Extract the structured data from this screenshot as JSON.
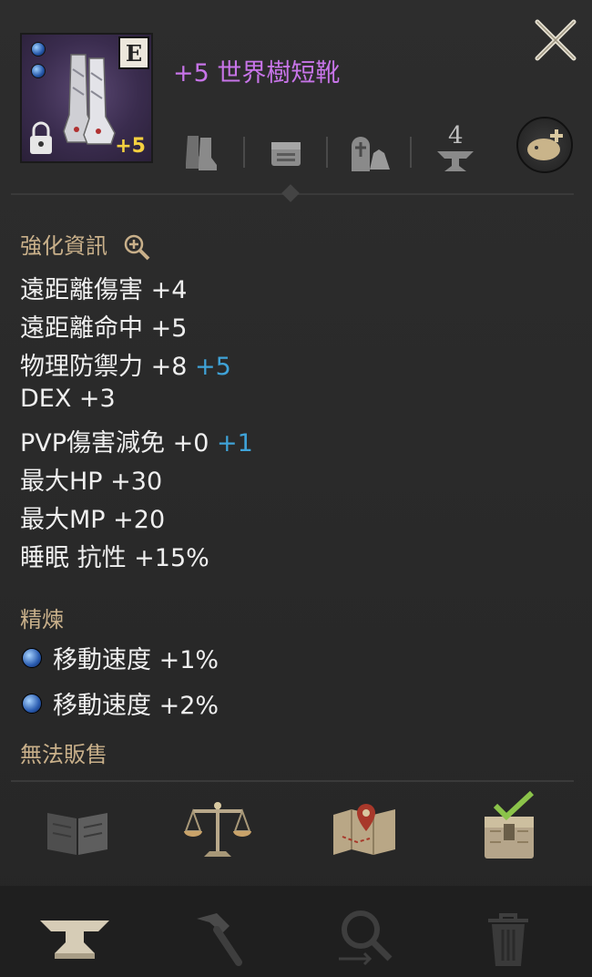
{
  "item": {
    "grade": "E",
    "enchant": "+5",
    "name": "+5 世界樹短靴"
  },
  "header_icons": {
    "enhance_count": "4"
  },
  "enhance_section": {
    "title": "強化資訊",
    "stats": [
      {
        "label": "遠距離傷害 +4",
        "bonus": ""
      },
      {
        "label": "遠距離命中 +5",
        "bonus": ""
      },
      {
        "label": "物理防禦力 +8",
        "bonus": "+5"
      },
      {
        "label": "DEX +3",
        "bonus": ""
      },
      {
        "label": "PVP傷害減免 +0",
        "bonus": "+1"
      },
      {
        "label": "最大HP +30",
        "bonus": ""
      },
      {
        "label": "最大MP +20",
        "bonus": ""
      },
      {
        "label": "睡眠 抗性 +15%",
        "bonus": ""
      }
    ]
  },
  "refine_section": {
    "title": "精煉",
    "lines": [
      {
        "label": "移動速度 +1%"
      },
      {
        "label": "移動速度 +2%"
      }
    ]
  },
  "unsellable_text": "無法販售",
  "colors": {
    "item_name": "#c774e8",
    "section_label": "#c9b08a",
    "bonus": "#3fa3d8",
    "enchant": "#f4d03f"
  },
  "icons": {
    "actions": [
      "book-icon",
      "scales-icon",
      "map-icon",
      "chest-check-icon"
    ],
    "bottom": [
      "anvil-icon",
      "hammer-icon",
      "magnifier-swap-icon",
      "trash-icon"
    ]
  }
}
